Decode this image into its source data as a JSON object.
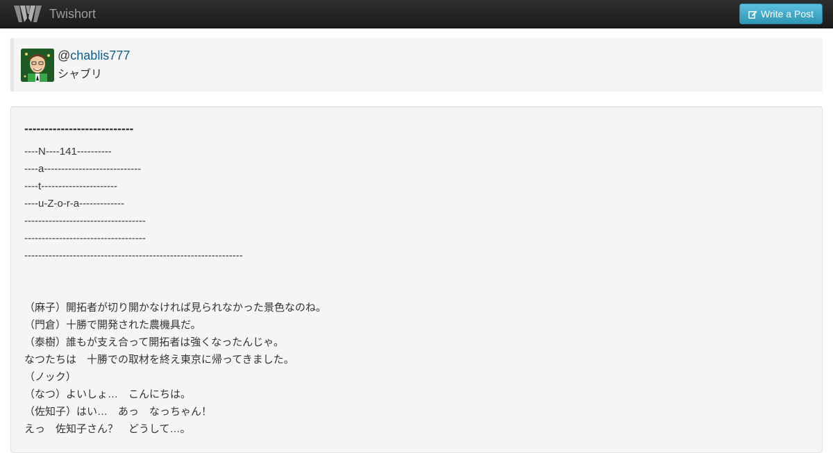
{
  "navbar": {
    "brand": "Twishort",
    "brand_icon": "twishort-logo-icon",
    "write_button_label": "Write a Post",
    "write_button_icon": "edit-icon"
  },
  "colors": {
    "navbar_bg": "#222222",
    "button_accent": "#49afcd",
    "link": "#0e5c8c",
    "panel_bg": "#f5f5f5"
  },
  "profile": {
    "at": "@",
    "handle": "chablis777",
    "display_name": "シャブリ",
    "avatar_icon": "avatar-caricature"
  },
  "post": {
    "title": "---------------------------",
    "lines": [
      "----N----141----------",
      "----a----------------------------",
      "----t----------------------",
      "----u-Z-o-r-a-------------",
      "-----------------------------------",
      "-----------------------------------",
      "---------------------------------------------------------------",
      "",
      "",
      "（麻子）開拓者が切り開かなければ見られなかった景色なのね。",
      "（門倉）十勝で開発された農機具だ。",
      "（泰樹）誰もが支え合って開拓者は強くなったんじゃ。",
      "なつたちは　十勝での取材を終え東京に帰ってきました。",
      "（ノック）",
      "（なつ）よいしょ…　こんにちは。",
      "（佐知子）はい…　あっ　なっちゃん！",
      "えっ　佐知子さん？　どうして…。"
    ]
  }
}
